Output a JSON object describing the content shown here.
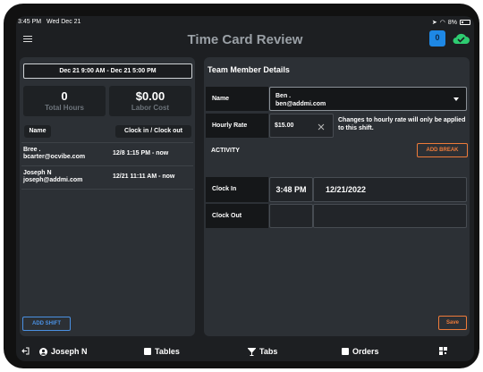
{
  "status_bar": {
    "time": "3:45 PM",
    "date": "Wed Dec 21",
    "battery": "8%"
  },
  "header": {
    "title": "Time Card Review",
    "chat_badge": "0"
  },
  "left": {
    "date_range": "Dec 21 9:00 AM - Dec 21 5:00 PM",
    "total_hours": {
      "value": "0",
      "label": "Total Hours"
    },
    "labor_cost": {
      "value": "$0.00",
      "label": "Labor Cost"
    },
    "columns": {
      "name": "Name",
      "clock": "Clock in / Clock out"
    },
    "rows": [
      {
        "name": "Bree .",
        "email": "bcarter@ocvibe.com",
        "time": "12/8 1:15 PM - now"
      },
      {
        "name": "Joseph N",
        "email": "joseph@addmi.com",
        "time": "12/21 11:11 AM - now"
      }
    ],
    "add_shift": "ADD SHIFT"
  },
  "right": {
    "title": "Team Member Details",
    "name_label": "Name",
    "name_value_line1": "Ben .",
    "name_value_line2": "ben@addmi.com",
    "hourly_label": "Hourly Rate",
    "hourly_value": "$15.00",
    "hourly_hint": "Changes to hourly rate will only be applied to this shift.",
    "activity_label": "ACTIVITY",
    "add_break": "ADD BREAK",
    "clock_in_label": "Clock In",
    "clock_in_time": "3:48 PM",
    "clock_in_date": "12/21/2022",
    "clock_out_label": "Clock Out",
    "save": "Save"
  },
  "bottom_nav": {
    "user": "Joseph N",
    "tables": "Tables",
    "tabs": "Tabs",
    "orders": "Orders"
  }
}
